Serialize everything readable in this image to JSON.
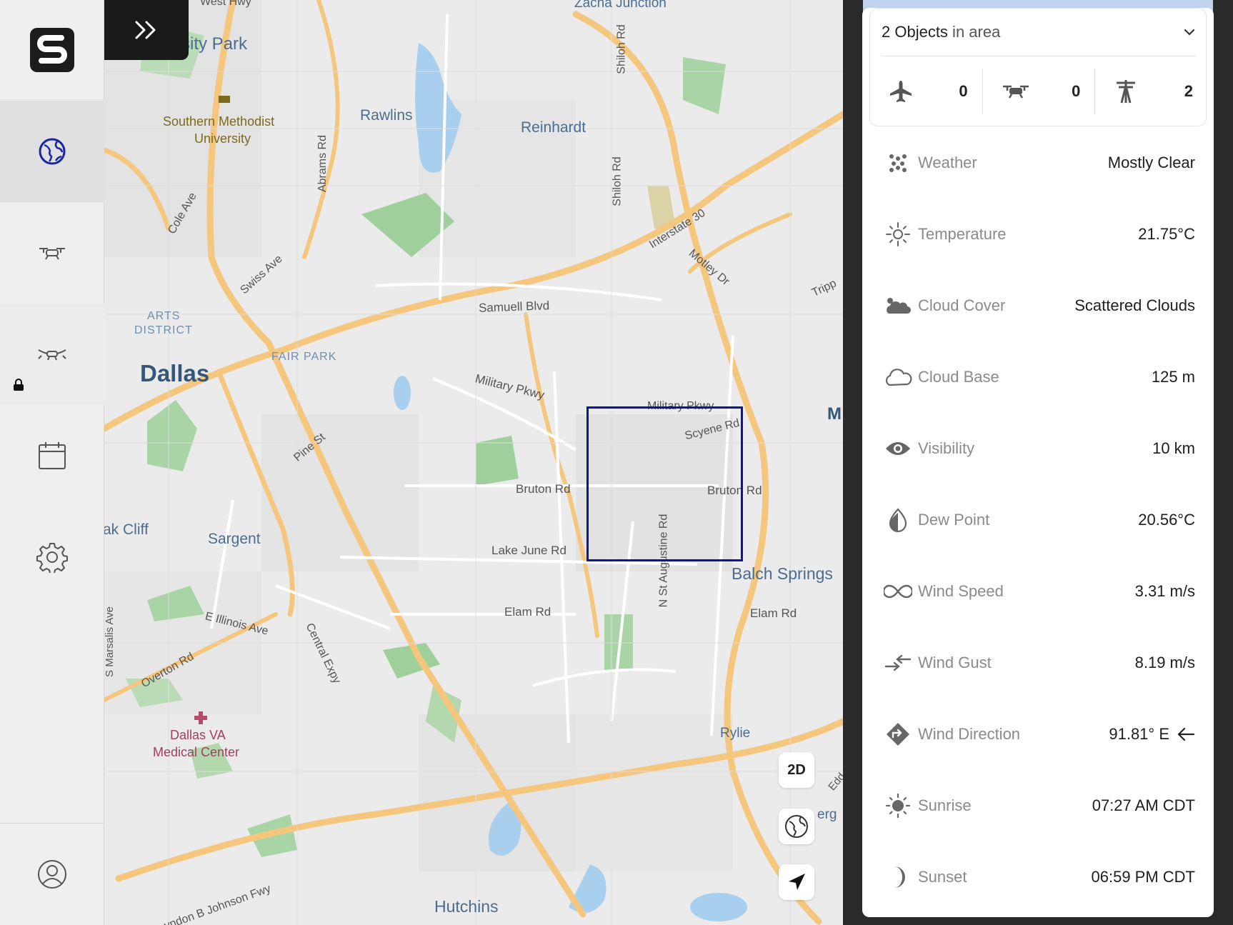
{
  "sidebar": {
    "items": [
      {
        "name": "globe"
      },
      {
        "name": "drone"
      },
      {
        "name": "drone-swarm",
        "locked": true
      },
      {
        "name": "calendar"
      },
      {
        "name": "settings"
      }
    ]
  },
  "map": {
    "labels": {
      "zacha_junction": "Zacha Junction",
      "univ_park": "sity Park",
      "smu": "Southern Methodist",
      "smu2": "University",
      "rawlins": "Rawlins",
      "reinhardt": "Reinhardt",
      "abrams": "Abrams Rd",
      "shiloh1": "Shiloh Rd",
      "shiloh2": "Shiloh Rd",
      "cole": "Cole Ave",
      "swiss": "Swiss Ave",
      "i30": "Interstate 30",
      "motley": "Motley Dr",
      "tripp": "Tripp",
      "samuell": "Samuell Blvd",
      "arts": "ARTS",
      "district": "DISTRICT",
      "fair_park": "FAIR PARK",
      "dallas": "Dallas",
      "military1": "Military Pkwy",
      "military2": "Military Pkwy",
      "scyene": "Scyene Rd",
      "m": "M",
      "pine": "Pine St",
      "bruton1": "Bruton Rd",
      "bruton2": "Bruton Rd",
      "oak_cliff": "ak Cliff",
      "sargent": "Sargent",
      "lake_june": "Lake June Rd",
      "nstaug": "N St Augustine Rd",
      "balch": "Balch Springs",
      "elam1": "Elam Rd",
      "elam2": "Elam Rd",
      "illinois": "E Illinois Ave",
      "marsalis": "S Marsalis Ave",
      "central": "Central Expy",
      "overton": "Overton Rd",
      "va1": "Dallas VA",
      "va2": "Medical Center",
      "rylie": "Rylie",
      "erg": "erg",
      "edd": "Edd",
      "lbj": "yndon B Johnson Fwy",
      "hutchins": "Hutchins",
      "west_hwy": "West Hwy"
    },
    "controls": {
      "mode_2d": "2D"
    }
  },
  "panel": {
    "summary": {
      "count_label": "2 Objects",
      "count_suffix": " in area",
      "counts": [
        {
          "icon": "airplane-icon",
          "value": "0"
        },
        {
          "icon": "drone-icon",
          "value": "0"
        },
        {
          "icon": "tower-icon",
          "value": "2"
        }
      ]
    },
    "weather_rows": [
      {
        "icon": "weather-icon",
        "label": "Weather",
        "value": "Mostly Clear"
      },
      {
        "icon": "temperature-icon",
        "label": "Temperature",
        "value": "21.75°C"
      },
      {
        "icon": "cloud-cover-icon",
        "label": "Cloud Cover",
        "value": "Scattered Clouds"
      },
      {
        "icon": "cloud-base-icon",
        "label": "Cloud Base",
        "value": "125 m"
      },
      {
        "icon": "visibility-icon",
        "label": "Visibility",
        "value": "10 km"
      },
      {
        "icon": "dew-point-icon",
        "label": "Dew Point",
        "value": "20.56°C"
      },
      {
        "icon": "wind-speed-icon",
        "label": "Wind Speed",
        "value": "3.31 m/s"
      },
      {
        "icon": "wind-gust-icon",
        "label": "Wind Gust",
        "value": "8.19 m/s"
      },
      {
        "icon": "wind-direction-icon",
        "label": "Wind Direction",
        "value": "91.81° E"
      },
      {
        "icon": "sunrise-icon",
        "label": "Sunrise",
        "value": "07:27 AM CDT"
      },
      {
        "icon": "sunset-icon",
        "label": "Sunset",
        "value": "06:59 PM CDT"
      }
    ]
  },
  "colors": {
    "accent": "#0b149a",
    "road": "#f5c77e",
    "water": "#a9cfee",
    "park": "#8dc98d"
  }
}
